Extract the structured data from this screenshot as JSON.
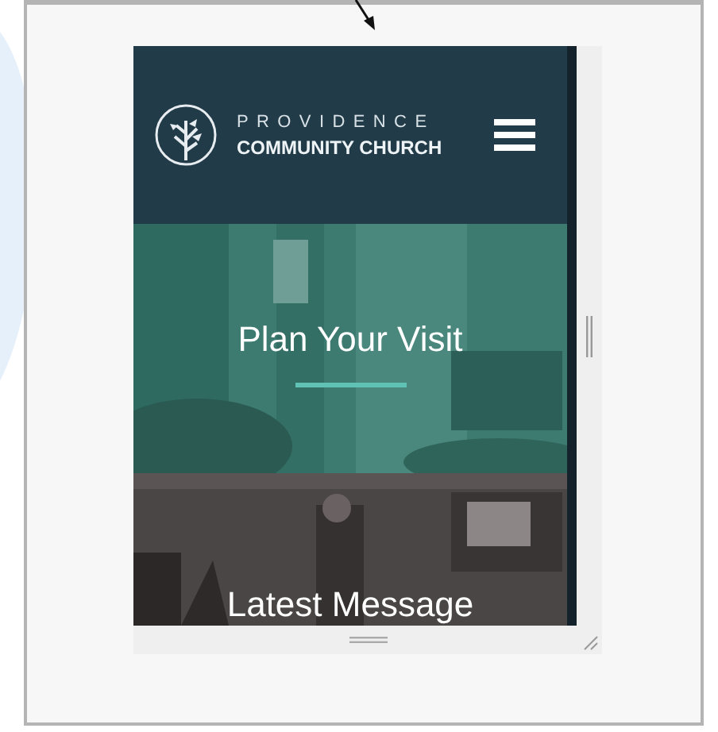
{
  "header": {
    "logo_top": "PROVIDENCE",
    "logo_bottom": "COMMUNITY CHURCH"
  },
  "sections": [
    {
      "kind": "visit",
      "title": "Plan Your Visit"
    },
    {
      "kind": "message",
      "title": "Latest Message"
    }
  ]
}
